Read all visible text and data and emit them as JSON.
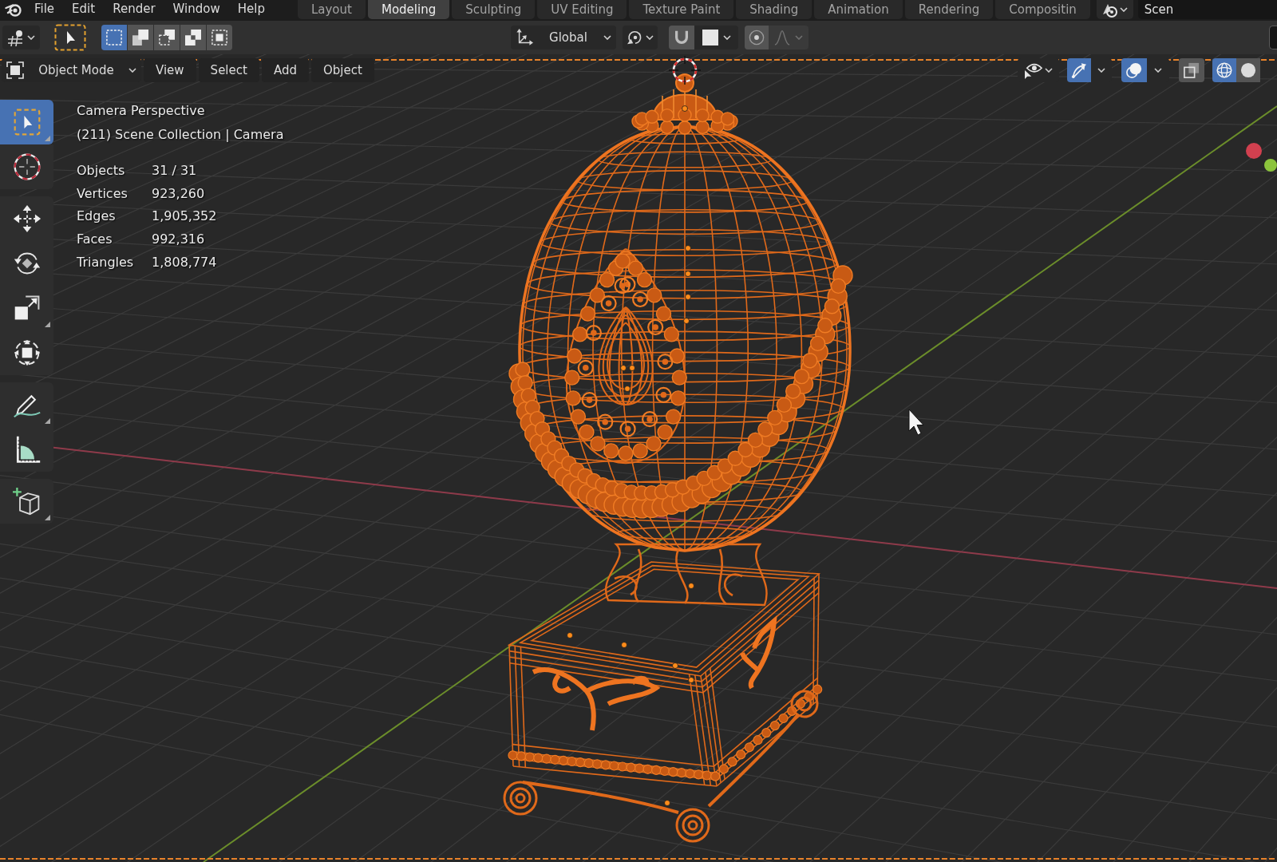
{
  "menu_bar": {
    "items": [
      "File",
      "Edit",
      "Render",
      "Window",
      "Help"
    ]
  },
  "workspaces": [
    {
      "label": "Layout",
      "selected": false
    },
    {
      "label": "Modeling",
      "selected": true
    },
    {
      "label": "Sculpting",
      "selected": false
    },
    {
      "label": "UV Editing",
      "selected": false
    },
    {
      "label": "Texture Paint",
      "selected": false
    },
    {
      "label": "Shading",
      "selected": false
    },
    {
      "label": "Animation",
      "selected": false
    },
    {
      "label": "Rendering",
      "selected": false
    },
    {
      "label": "Compositin",
      "selected": false
    }
  ],
  "scene": {
    "label": "Scen"
  },
  "tool_header": {
    "select_modes": [
      {
        "kind": "set",
        "selected": true
      },
      {
        "kind": "extend",
        "selected": false
      },
      {
        "kind": "subtract",
        "selected": false
      },
      {
        "kind": "difference",
        "selected": false
      },
      {
        "kind": "intersect",
        "selected": false
      }
    ],
    "orientation": "Global",
    "snap": {
      "on": false
    },
    "proportional_editing": {
      "on": false
    }
  },
  "viewport_header": {
    "mode": "Object Mode",
    "menus": [
      "View",
      "Select",
      "Add",
      "Object"
    ],
    "gizmos": {
      "on": true
    },
    "overlays": {
      "on": true
    },
    "xray": {
      "on": false
    },
    "shading": [
      {
        "kind": "wireframe",
        "selected": true
      },
      {
        "kind": "solid",
        "selected": false
      }
    ]
  },
  "toolbar": {
    "groups": [
      {
        "tools": [
          {
            "kind": "select_box",
            "selected": true,
            "flyout": true
          },
          {
            "kind": "cursor",
            "selected": false,
            "flyout": false
          }
        ]
      },
      {
        "tools": [
          {
            "kind": "move",
            "selected": false,
            "flyout": false
          },
          {
            "kind": "rotate",
            "selected": false,
            "flyout": false
          },
          {
            "kind": "scale",
            "selected": false,
            "flyout": true
          },
          {
            "kind": "transform",
            "selected": false,
            "flyout": false
          }
        ]
      },
      {
        "tools": [
          {
            "kind": "annotate",
            "selected": false,
            "flyout": true
          },
          {
            "kind": "measure",
            "selected": false,
            "flyout": false
          }
        ]
      },
      {
        "tools": [
          {
            "kind": "add_cube",
            "selected": false,
            "flyout": true
          }
        ]
      }
    ]
  },
  "overlay_text": {
    "view": "Camera Perspective",
    "context": "(211) Scene Collection | Camera",
    "stats": [
      {
        "label": "Objects",
        "value": "31 / 31"
      },
      {
        "label": "Vertices",
        "value": "923,260"
      },
      {
        "label": "Edges",
        "value": "1,905,352"
      },
      {
        "label": "Faces",
        "value": "992,316"
      },
      {
        "label": "Triangles",
        "value": "1,808,774"
      }
    ]
  }
}
